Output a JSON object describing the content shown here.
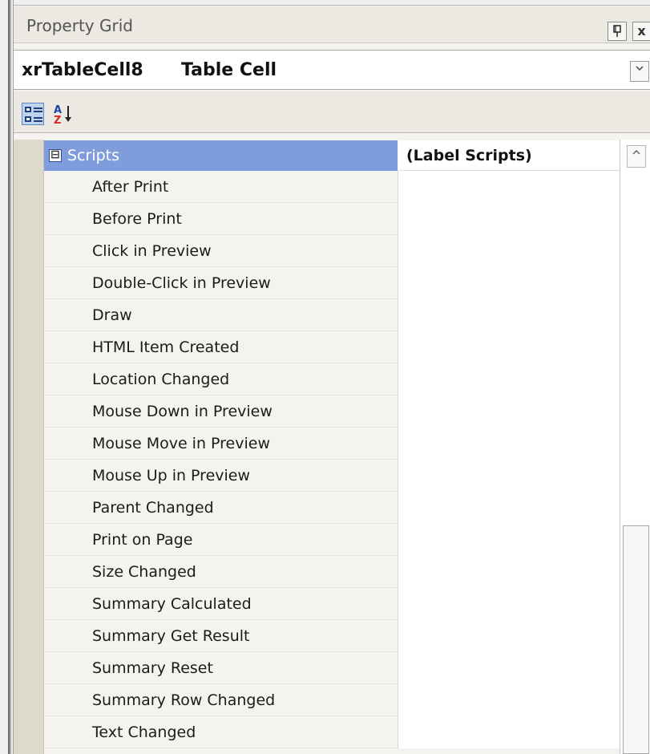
{
  "panel": {
    "title": "Property Grid",
    "pin_icon": "pin-icon",
    "close_label": "x"
  },
  "selector": {
    "name": "xrTableCell8",
    "type": "Table Cell",
    "dropdown_icon": "chevron-down-icon"
  },
  "toolbar": {
    "categorized_icon": "categorized-icon",
    "alphabetical_icon": "sort-az-icon"
  },
  "grid": {
    "category": {
      "label": "Scripts",
      "value": "(Label Scripts)",
      "toggle": "⊟"
    },
    "rows": [
      {
        "label": "After Print",
        "value": ""
      },
      {
        "label": "Before Print",
        "value": ""
      },
      {
        "label": "Click in Preview",
        "value": ""
      },
      {
        "label": "Double-Click in Preview",
        "value": ""
      },
      {
        "label": "Draw",
        "value": ""
      },
      {
        "label": "HTML Item Created",
        "value": ""
      },
      {
        "label": "Location Changed",
        "value": ""
      },
      {
        "label": "Mouse Down in Preview",
        "value": ""
      },
      {
        "label": "Mouse Move in Preview",
        "value": ""
      },
      {
        "label": "Mouse Up in Preview",
        "value": ""
      },
      {
        "label": "Parent Changed",
        "value": ""
      },
      {
        "label": "Print on Page",
        "value": ""
      },
      {
        "label": "Size Changed",
        "value": ""
      },
      {
        "label": "Summary Calculated",
        "value": ""
      },
      {
        "label": "Summary Get Result",
        "value": ""
      },
      {
        "label": "Summary Reset",
        "value": ""
      },
      {
        "label": "Summary Row Changed",
        "value": ""
      },
      {
        "label": "Text Changed",
        "value": ""
      }
    ]
  },
  "colors": {
    "selected_category": "#7f9cdc",
    "panel_background": "#f4f3ef",
    "grid_value_background": "#ffffff"
  }
}
